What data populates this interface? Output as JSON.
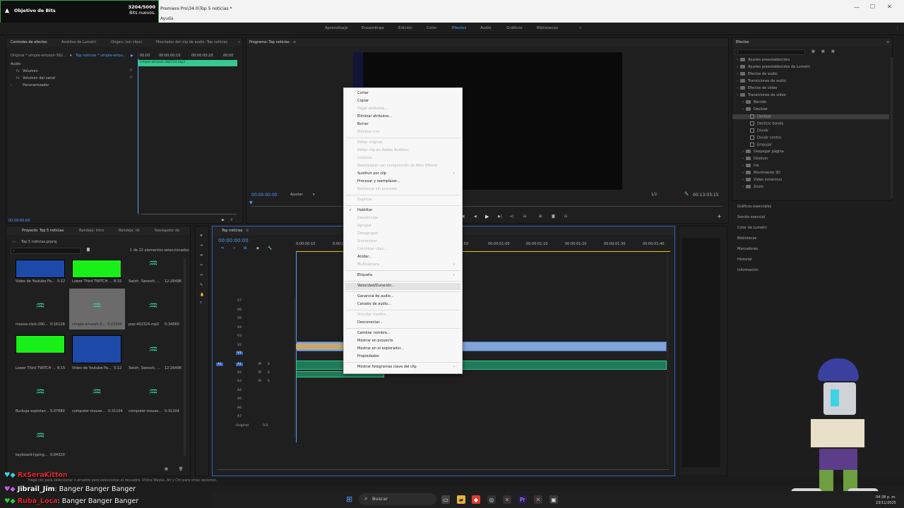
{
  "window": {
    "title": "Premiere Pro\\34.0\\Top 5 noticias *"
  },
  "menu": {
    "help": "Ayuda"
  },
  "bits_goal": {
    "title": "Objetivo de Bits",
    "count": "3204/5000",
    "subtitle": "Bits nuevos.",
    "progress": 0.64
  },
  "workspaces": [
    "Aprendizaje",
    "Ensamblaje",
    "Edición",
    "Color",
    "Efectos",
    "Audio",
    "Gráficos",
    "Bibliotecas"
  ],
  "workspace_active": "Efectos",
  "effect_controls": {
    "tabs": [
      "Controles de efectos",
      "Ámbitos de Lumetri",
      "Origen: (sin clips)",
      "Mezclador del clip de audio: Top noticias"
    ],
    "source": "Original * simple-whoosh-382...",
    "seq": "Top noticias * simple-whoo...",
    "section": "Audio",
    "props": [
      "Volumen",
      "Volumen del canal",
      "Panoramizador"
    ],
    "times": [
      "00:00",
      "00:00:00:10",
      "00:00:00:20",
      "00:00"
    ],
    "clip_name": "simple-whoosh-382724.mp3",
    "timecode": "00:00:00:00"
  },
  "program": {
    "tab": "Programa: Top noticias",
    "timecode": "00:00:00:00",
    "fit": "Ajustar",
    "ratio": "1/2",
    "duration": "00:13:03:15"
  },
  "project": {
    "tabs": [
      "Proyecto: Top 5 noticias",
      "Bandeja: Intro",
      "Bandeja: nk",
      "Navegador de"
    ],
    "file": "Top 5 noticias.prproj",
    "count": "1 de 22 elementos seleccionados",
    "items": [
      {
        "name": "Video de Youtube Pa...",
        "dur": "5:12"
      },
      {
        "name": "Lower Third TWITCH ...",
        "dur": "8:15"
      },
      {
        "name": "Swish, Swoosh, ...",
        "dur": "12:26496"
      },
      {
        "name": "mouse-click-290...",
        "dur": "0:16128"
      },
      {
        "name": "simple-whoosh-3...",
        "dur": "0:23544"
      },
      {
        "name": "pop-402324.mp3",
        "dur": "0:34560"
      },
      {
        "name": "Lower Third TWITCH ...",
        "dur": "8:15"
      },
      {
        "name": "Video de Youtube Pa...",
        "dur": "5:12"
      },
      {
        "name": "Swish, Swoosh, ...",
        "dur": "12:26496"
      },
      {
        "name": "Burbuja explotan...",
        "dur": "5:07680"
      },
      {
        "name": "computer-mouse...",
        "dur": "0:31104"
      },
      {
        "name": "computer-mouse...",
        "dur": "0:31104"
      },
      {
        "name": "keyboard-typing...",
        "dur": "0:04320"
      }
    ]
  },
  "timeline": {
    "tab": "Top noticias",
    "timecode": "00:00:00:00",
    "ruler": [
      "0:00:00:10",
      "0:00:00:20",
      ":50",
      "00:00:01:00",
      "00:00:01:10",
      "00:00:01:20",
      "00:00:01:30",
      "00:00:01:40"
    ],
    "video_tracks": [
      "V7",
      "V6",
      "V5",
      "V4",
      "V3",
      "V2",
      "V1"
    ],
    "audio_tracks": [
      "A1",
      "A2",
      "A3",
      "A4",
      "A5",
      "A6",
      "A7"
    ],
    "source_patch": "A1",
    "mix": "Original",
    "mix_val": "0.0",
    "m": "M",
    "s": "S"
  },
  "context_menu": [
    {
      "label": "Cortar",
      "enabled": true
    },
    {
      "label": "Copiar",
      "enabled": true
    },
    {
      "label": "Pegar atributos...",
      "enabled": false
    },
    {
      "label": "Eliminar atributos...",
      "enabled": true
    },
    {
      "label": "Borrar",
      "enabled": true
    },
    {
      "label": "Eliminar rizo",
      "enabled": false
    },
    {
      "sep": true
    },
    {
      "label": "Editar original",
      "enabled": false
    },
    {
      "label": "Editar clip en Adobe Audition",
      "enabled": false
    },
    {
      "label": "Licencia...",
      "enabled": false
    },
    {
      "label": "Reemplazar con composición de After Effects",
      "enabled": false
    },
    {
      "label": "Sustituir por clip",
      "enabled": true,
      "submenu": true
    },
    {
      "label": "Procesar y reemplazar...",
      "enabled": true
    },
    {
      "label": "Restaurar sin procesar",
      "enabled": false
    },
    {
      "sep": true
    },
    {
      "label": "Duplicar",
      "enabled": false
    },
    {
      "sep": true
    },
    {
      "label": "Habilitar",
      "enabled": true,
      "checked": true
    },
    {
      "label": "Desvincular",
      "enabled": false
    },
    {
      "label": "Agrupar",
      "enabled": false
    },
    {
      "label": "Desagrupar",
      "enabled": false
    },
    {
      "label": "Sincronizar",
      "enabled": false
    },
    {
      "label": "Combinar clips...",
      "enabled": false
    },
    {
      "label": "Anidar...",
      "enabled": true
    },
    {
      "label": "Multicámara",
      "enabled": false,
      "submenu": true
    },
    {
      "sep": true
    },
    {
      "label": "Etiqueta",
      "enabled": true,
      "submenu": true
    },
    {
      "sep": true
    },
    {
      "label": "Velocidad/Duración...",
      "enabled": true,
      "hover": true
    },
    {
      "sep": true
    },
    {
      "label": "Ganancia de audio...",
      "enabled": true
    },
    {
      "label": "Canales de audio...",
      "enabled": true
    },
    {
      "sep": true
    },
    {
      "label": "Vincular medios...",
      "enabled": false
    },
    {
      "label": "Desconectar...",
      "enabled": true
    },
    {
      "sep": true
    },
    {
      "label": "Cambiar nombre...",
      "enabled": true
    },
    {
      "label": "Mostrar en proyecto",
      "enabled": true
    },
    {
      "label": "Mostrar en el explorador...",
      "enabled": true
    },
    {
      "label": "Propiedades",
      "enabled": true
    },
    {
      "sep": true
    },
    {
      "label": "Mostrar fotogramas clave del clip",
      "enabled": true,
      "submenu": true
    }
  ],
  "effects_panel": {
    "title": "Efectos",
    "tree": [
      {
        "label": "Ajustes preestablecidos",
        "level": 0,
        "type": "folder"
      },
      {
        "label": "Ajustes preestablecidos de Lumetri",
        "level": 0,
        "type": "folder"
      },
      {
        "label": "Efectos de audio",
        "level": 0,
        "type": "folder"
      },
      {
        "label": "Transiciones de audio",
        "level": 0,
        "type": "folder"
      },
      {
        "label": "Efectos de vídeo",
        "level": 0,
        "type": "folder"
      },
      {
        "label": "Transiciones de vídeo",
        "level": 0,
        "type": "folder"
      },
      {
        "label": "Barrido",
        "level": 1,
        "type": "folder"
      },
      {
        "label": "Deslizar",
        "level": 1,
        "type": "folder"
      },
      {
        "label": "Deslizar",
        "level": 2,
        "type": "preset",
        "selected": true
      },
      {
        "label": "Deslizar banda",
        "level": 2,
        "type": "preset"
      },
      {
        "label": "Dividir",
        "level": 2,
        "type": "preset"
      },
      {
        "label": "Dividir centro",
        "level": 2,
        "type": "preset"
      },
      {
        "label": "Empujar",
        "level": 2,
        "type": "preset"
      },
      {
        "label": "Despegar página",
        "level": 1,
        "type": "folder"
      },
      {
        "label": "Disolver",
        "level": 1,
        "type": "folder"
      },
      {
        "label": "Iris",
        "level": 1,
        "type": "folder"
      },
      {
        "label": "Movimiento 3D",
        "level": 1,
        "type": "folder"
      },
      {
        "label": "Vídeo inmersivo",
        "level": 1,
        "type": "folder"
      },
      {
        "label": "Zoom",
        "level": 1,
        "type": "folder"
      }
    ],
    "sections": [
      "Gráficos esenciales",
      "Sonido esencial",
      "Color de Lumetri",
      "Bibliotecas",
      "Marcadores",
      "Historial",
      "Información"
    ]
  },
  "status_bar": {
    "hint": "Haga clic para seleccionar o arrastre para seleccionar el recuadro. Utilice Mayús, Alt y Ctrl para otras opciones."
  },
  "chat": [
    {
      "user": "RxSeraKitton",
      "message": "",
      "color": "#e2262e"
    },
    {
      "user": "Jibrail_Jim",
      "message": "Banger Banger Banger",
      "color": "#ffffff"
    },
    {
      "user": "Ruba_Loca",
      "message": "Banger Banger Banger",
      "color": "#e2262e"
    }
  ],
  "taskbar": {
    "search": "Buscar",
    "time": "04:38 p. m.",
    "date": "23/11/2025"
  },
  "colors": {
    "accent": "#4f9fff",
    "audio_clip": "#36c88e",
    "video_clip": "#7fa4d8",
    "green_thumb": "#19f019",
    "blue_thumb": "#1d49a9"
  }
}
